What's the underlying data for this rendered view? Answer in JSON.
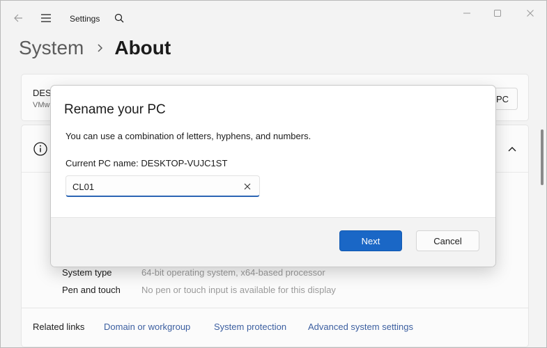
{
  "app": {
    "title": "Settings"
  },
  "breadcrumb": {
    "parent": "System",
    "current": "About"
  },
  "device": {
    "name": "DESK",
    "model": "VMw",
    "rename_label": "PC"
  },
  "specs": [
    {
      "label": "System type",
      "value": "64-bit operating system, x64-based processor"
    },
    {
      "label": "Pen and touch",
      "value": "No pen or touch input is available for this display"
    }
  ],
  "related": {
    "title": "Related links",
    "links": [
      "Domain or workgroup",
      "System protection",
      "Advanced system settings"
    ]
  },
  "dialog": {
    "title": "Rename your PC",
    "description": "You can use a combination of letters, hyphens, and numbers.",
    "current_name": "Current PC name: DESKTOP-VUJC1ST",
    "input_value": "CL01",
    "next_label": "Next",
    "cancel_label": "Cancel"
  },
  "colors": {
    "accent": "#1a67c6",
    "link": "#3c5fa0",
    "background": "#f3f3f3"
  },
  "icons": [
    "back-arrow-icon",
    "hamburger-icon",
    "search-icon",
    "minimize-icon",
    "maximize-icon",
    "close-icon",
    "chevron-right-icon",
    "info-icon",
    "chevron-up-icon",
    "clear-icon"
  ]
}
